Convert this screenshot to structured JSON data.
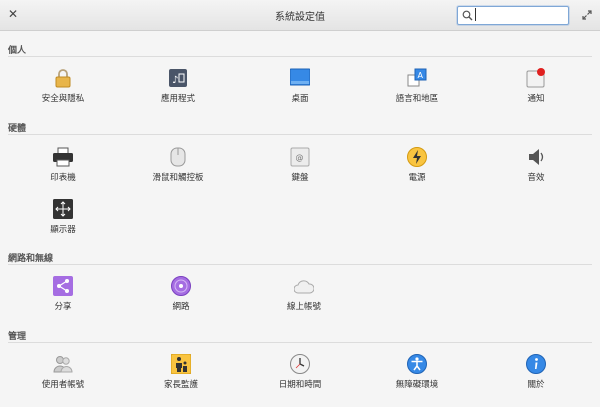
{
  "window": {
    "title": "系統設定值"
  },
  "search": {
    "value": "",
    "placeholder": ""
  },
  "sections": {
    "personal": {
      "title": "個人",
      "items": [
        "安全與隱私",
        "應用程式",
        "桌面",
        "語言和地區",
        "通知"
      ]
    },
    "hardware": {
      "title": "硬體",
      "items": [
        "印表機",
        "滑鼠和觸控板",
        "鍵盤",
        "電源",
        "音效",
        "顯示器"
      ]
    },
    "network": {
      "title": "網路和無線",
      "items": [
        "分享",
        "網路",
        "線上帳號"
      ]
    },
    "admin": {
      "title": "管理",
      "items": [
        "使用者帳號",
        "家長監護",
        "日期和時間",
        "無障礙環境",
        "關於"
      ]
    }
  },
  "icons": {
    "personal": [
      "lock-icon",
      "applications-icon",
      "desktop-icon",
      "language-icon",
      "notifications-icon"
    ],
    "hardware": [
      "printer-icon",
      "mouse-icon",
      "keyboard-icon",
      "power-icon",
      "sound-icon",
      "display-icon"
    ],
    "network": [
      "sharing-icon",
      "network-icon",
      "online-accounts-icon"
    ],
    "admin": [
      "users-icon",
      "parental-control-icon",
      "clock-icon",
      "accessibility-icon",
      "about-icon"
    ]
  },
  "colors": {
    "accent": "#3689e6",
    "power": "#f9c440",
    "sharing": "#a56de2",
    "notification_badge": "#e0201f"
  }
}
